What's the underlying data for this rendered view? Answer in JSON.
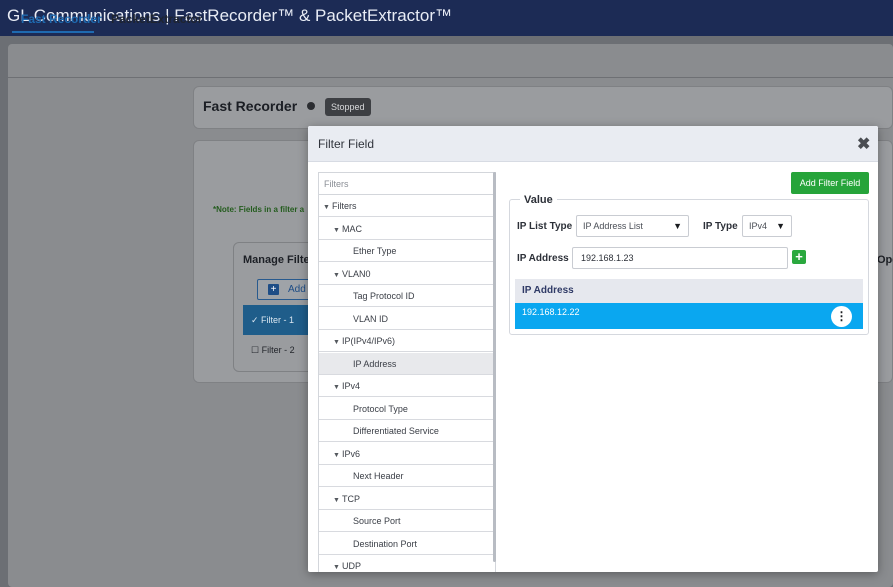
{
  "app": {
    "title": "GL Communications  |  FastRecorder™ & PacketExtractor™"
  },
  "tabs": [
    {
      "label": "Fast Recorder",
      "active": true
    },
    {
      "label": "PacketExtractor",
      "active": false
    }
  ],
  "background": {
    "fast_recorder_title": "Fast Recorder",
    "status_badge": "Stopped",
    "note": "*Note: Fields in a filter a",
    "manage_filters_title": "Manage Filte",
    "add_button_label": "Add",
    "filters": [
      "Filter - 1",
      "Filter - 2"
    ],
    "right_cut_label": "Ope"
  },
  "modal": {
    "title": "Filter Field",
    "close_symbol": "✖",
    "tree": {
      "search_placeholder": "Filters",
      "items": [
        {
          "label": "Filters",
          "level": 0,
          "expanded": true
        },
        {
          "label": "MAC",
          "level": 1,
          "expanded": true
        },
        {
          "label": "Ether Type",
          "level": 2
        },
        {
          "label": "VLAN0",
          "level": 1,
          "expanded": true
        },
        {
          "label": "Tag Protocol ID",
          "level": 2
        },
        {
          "label": "VLAN ID",
          "level": 2
        },
        {
          "label": "IP(IPv4/IPv6)",
          "level": 1,
          "expanded": true
        },
        {
          "label": "IP Address",
          "level": 2,
          "selected": true
        },
        {
          "label": "IPv4",
          "level": 1,
          "expanded": true
        },
        {
          "label": "Protocol Type",
          "level": 2
        },
        {
          "label": "Differentiated Service",
          "level": 2
        },
        {
          "label": "IPv6",
          "level": 1,
          "expanded": true
        },
        {
          "label": "Next Header",
          "level": 2
        },
        {
          "label": "TCP",
          "level": 1,
          "expanded": true
        },
        {
          "label": "Source Port",
          "level": 2
        },
        {
          "label": "Destination Port",
          "level": 2
        },
        {
          "label": "UDP",
          "level": 1,
          "expanded": true
        }
      ]
    },
    "add_filter_field_label": "Add Filter Field",
    "value_section": {
      "legend": "Value",
      "ip_list_type_label": "IP List Type",
      "ip_list_type_value": "IP Address List",
      "ip_type_label": "IP Type",
      "ip_type_value": "IPv4",
      "ip_address_label": "IP Address",
      "ip_address_value": "192.168.1.23",
      "table_header": "IP Address",
      "rows": [
        "192.168.12.22"
      ]
    }
  },
  "colors": {
    "header_bg": "#1c2b55",
    "accent_blue": "#1e6ab0",
    "green_button": "#26a43a",
    "row_highlight": "#0aa7f0"
  }
}
